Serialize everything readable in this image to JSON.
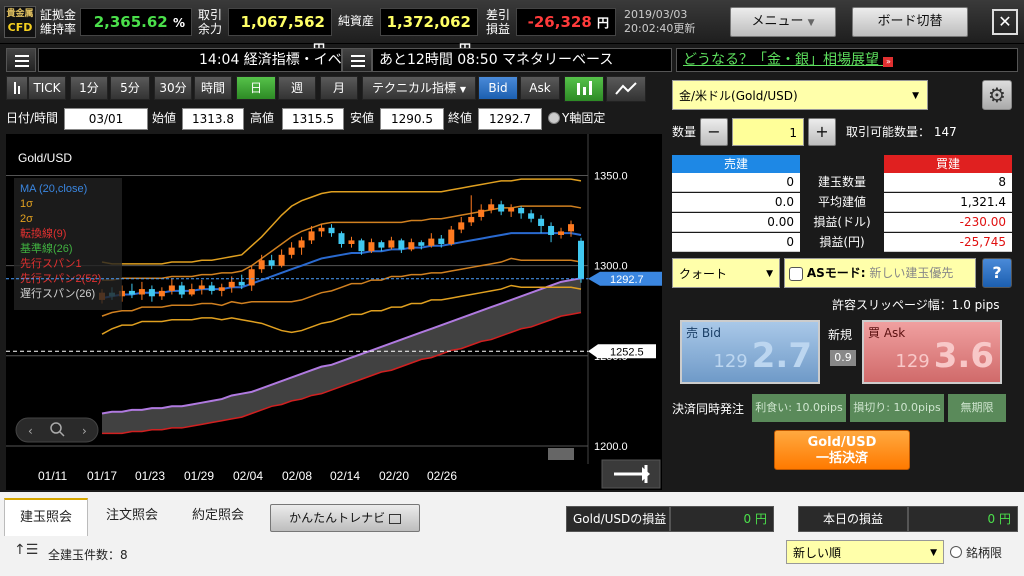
{
  "header": {
    "logo_line1": "貴金属",
    "logo_line2": "CFD",
    "margin_label1": "証拠金",
    "margin_label2": "維持率",
    "margin_value": "2,365.62",
    "margin_unit": "%",
    "avail_label1": "取引",
    "avail_label2": "余力",
    "avail_value": "1,067,562",
    "yen": "円",
    "net_label": "純資産",
    "net_value": "1,372,062",
    "pl_label1": "差引",
    "pl_label2": "損益",
    "pl_value": "-26,328",
    "date": "2019/03/03",
    "time_updated": "20:02:40更新",
    "menu_label": "メニュー",
    "board_label": "ボード切替",
    "close_glyph": "✕"
  },
  "tickers": {
    "t1": "14:04 経済指標・イベ",
    "t2": "あと12時間 08:50 マネタリーベース",
    "t3": "どうなる？「金・銀」相場展望"
  },
  "toolbar": {
    "items": [
      "TICK",
      "1分",
      "5分",
      "30分",
      "時間",
      "日",
      "週",
      "月"
    ],
    "tech": "テクニカル指標",
    "bid": "Bid",
    "ask": "Ask"
  },
  "ohlc": {
    "date_label": "日付/時間",
    "date": "03/01",
    "open_label": "始値",
    "open": "1313.8",
    "high_label": "高値",
    "high": "1315.5",
    "low_label": "安値",
    "low": "1290.5",
    "close_label": "終値",
    "close": "1292.7",
    "yfix_label": "Y軸固定"
  },
  "chart_data": {
    "type": "candlestick",
    "symbol": "Gold/USD",
    "legend": [
      "MA (20,close)",
      "1σ",
      "2σ",
      "転換線(9)",
      "基準線(26)",
      "先行スパン1",
      "先行スパン2(52)",
      "遅行スパン(26)"
    ],
    "y_ticks": [
      1350.0,
      1300.0,
      1250.0,
      1200.0
    ],
    "y_tick_labels": [
      "1350.0",
      "1300.0",
      "1250.0",
      "1200.0"
    ],
    "ylim": [
      1190,
      1373
    ],
    "x_labels": [
      "01/11",
      "01/17",
      "01/23",
      "01/29",
      "02/04",
      "02/08",
      "02/14",
      "02/20",
      "02/26"
    ],
    "current_price": "1292.7",
    "marker_price": "1252.5",
    "candles": [
      [
        1281,
        1285,
        1279,
        1287
      ],
      [
        1285,
        1283,
        1281,
        1288
      ],
      [
        1283,
        1286,
        1280,
        1289
      ],
      [
        1286,
        1284,
        1282,
        1290
      ],
      [
        1284,
        1287,
        1281,
        1291
      ],
      [
        1287,
        1283,
        1280,
        1289
      ],
      [
        1283,
        1286,
        1281,
        1288
      ],
      [
        1286,
        1289,
        1284,
        1293
      ],
      [
        1289,
        1284,
        1282,
        1291
      ],
      [
        1284,
        1287,
        1283,
        1290
      ],
      [
        1287,
        1289,
        1284,
        1292
      ],
      [
        1289,
        1286,
        1284,
        1291
      ],
      [
        1286,
        1288,
        1283,
        1290
      ],
      [
        1288,
        1291,
        1285,
        1294
      ],
      [
        1291,
        1289,
        1287,
        1295
      ],
      [
        1289,
        1298,
        1286,
        1300
      ],
      [
        1298,
        1303,
        1296,
        1306
      ],
      [
        1303,
        1300,
        1298,
        1306
      ],
      [
        1300,
        1306,
        1299,
        1309
      ],
      [
        1306,
        1310,
        1304,
        1313
      ],
      [
        1310,
        1314,
        1306,
        1316
      ],
      [
        1314,
        1319,
        1312,
        1322
      ],
      [
        1319,
        1321,
        1316,
        1323
      ],
      [
        1321,
        1318,
        1316,
        1323
      ],
      [
        1318,
        1312,
        1310,
        1319
      ],
      [
        1312,
        1314,
        1310,
        1316
      ],
      [
        1314,
        1308,
        1306,
        1315
      ],
      [
        1308,
        1313,
        1307,
        1315
      ],
      [
        1313,
        1310,
        1308,
        1314
      ],
      [
        1310,
        1314,
        1309,
        1316
      ],
      [
        1314,
        1309,
        1307,
        1315
      ],
      [
        1309,
        1313,
        1308,
        1315
      ],
      [
        1313,
        1311,
        1309,
        1314
      ],
      [
        1311,
        1315,
        1310,
        1318
      ],
      [
        1315,
        1312,
        1310,
        1317
      ],
      [
        1312,
        1320,
        1311,
        1322
      ],
      [
        1320,
        1324,
        1318,
        1327
      ],
      [
        1324,
        1327,
        1322,
        1339
      ],
      [
        1327,
        1331,
        1325,
        1334
      ],
      [
        1331,
        1334,
        1329,
        1337
      ],
      [
        1334,
        1330,
        1328,
        1336
      ],
      [
        1330,
        1332,
        1327,
        1334
      ],
      [
        1332,
        1329,
        1326,
        1333
      ],
      [
        1329,
        1326,
        1324,
        1331
      ],
      [
        1326,
        1322,
        1318,
        1328
      ],
      [
        1322,
        1317,
        1313,
        1324
      ],
      [
        1317,
        1319,
        1315,
        1321
      ],
      [
        1319,
        1323,
        1316,
        1325
      ],
      [
        1313.8,
        1292.7,
        1290.5,
        1315.5
      ]
    ],
    "ma20": [
      1282,
      1283,
      1284,
      1284,
      1285,
      1285,
      1285,
      1286,
      1286,
      1286,
      1287,
      1287,
      1287,
      1288,
      1288,
      1290,
      1292,
      1294,
      1296,
      1298,
      1300,
      1302,
      1304,
      1305,
      1306,
      1307,
      1307,
      1308,
      1308,
      1309,
      1309,
      1310,
      1310,
      1311,
      1311,
      1312,
      1313,
      1314,
      1315,
      1316,
      1317,
      1318,
      1318,
      1318,
      1318,
      1318,
      1318,
      1318,
      1317
    ],
    "sigma1_upper": [
      1292,
      1292,
      1293,
      1293,
      1293,
      1293,
      1293,
      1294,
      1294,
      1294,
      1295,
      1295,
      1296,
      1296,
      1297,
      1300,
      1304,
      1308,
      1312,
      1316,
      1319,
      1321,
      1323,
      1324,
      1324,
      1324,
      1324,
      1324,
      1324,
      1324,
      1324,
      1325,
      1325,
      1326,
      1326,
      1327,
      1328,
      1329,
      1330,
      1331,
      1332,
      1332,
      1333,
      1333,
      1333,
      1333,
      1333,
      1333,
      1332
    ],
    "sigma2_upper": [
      1302,
      1301,
      1301,
      1301,
      1301,
      1301,
      1301,
      1302,
      1302,
      1302,
      1303,
      1303,
      1304,
      1305,
      1306,
      1311,
      1316,
      1322,
      1328,
      1333,
      1336,
      1338,
      1340,
      1341,
      1341,
      1341,
      1341,
      1341,
      1341,
      1341,
      1341,
      1341,
      1341,
      1341,
      1341,
      1342,
      1343,
      1344,
      1345,
      1346,
      1347,
      1347,
      1348,
      1348,
      1348,
      1348,
      1348,
      1348,
      1347
    ],
    "sigma1_lower": [
      1272,
      1274,
      1275,
      1275,
      1277,
      1277,
      1277,
      1278,
      1278,
      1278,
      1279,
      1279,
      1278,
      1280,
      1279,
      1280,
      1280,
      1280,
      1280,
      1280,
      1281,
      1283,
      1285,
      1286,
      1288,
      1290,
      1290,
      1292,
      1292,
      1294,
      1294,
      1295,
      1295,
      1296,
      1296,
      1297,
      1298,
      1299,
      1300,
      1301,
      1302,
      1304,
      1303,
      1303,
      1303,
      1303,
      1303,
      1303,
      1302
    ],
    "sigma2_lower": [
      1262,
      1265,
      1267,
      1267,
      1269,
      1269,
      1269,
      1270,
      1270,
      1270,
      1271,
      1271,
      1270,
      1271,
      1270,
      1269,
      1268,
      1266,
      1264,
      1263,
      1264,
      1266,
      1268,
      1269,
      1271,
      1273,
      1273,
      1275,
      1275,
      1277,
      1277,
      1279,
      1279,
      1281,
      1281,
      1282,
      1283,
      1284,
      1285,
      1286,
      1287,
      1289,
      1288,
      1288,
      1288,
      1288,
      1288,
      1288,
      1287
    ],
    "span_a": [
      1218,
      1219,
      1219,
      1220,
      1220,
      1221,
      1221,
      1222,
      1222,
      1223,
      1224,
      1225,
      1226,
      1228,
      1229,
      1230,
      1232,
      1234,
      1236,
      1238,
      1240,
      1242,
      1244,
      1245,
      1247,
      1249,
      1251,
      1253,
      1255,
      1257,
      1259,
      1261,
      1263,
      1265,
      1267,
      1269,
      1271,
      1273,
      1275,
      1277,
      1279,
      1281,
      1283,
      1285,
      1287,
      1289,
      1291,
      1292,
      1293
    ],
    "span_b": [
      1207,
      1207,
      1207,
      1208,
      1208,
      1209,
      1209,
      1210,
      1210,
      1211,
      1212,
      1213,
      1214,
      1215,
      1216,
      1218,
      1220,
      1222,
      1223,
      1225,
      1226,
      1228,
      1229,
      1231,
      1233,
      1235,
      1237,
      1239,
      1241,
      1242,
      1244,
      1246,
      1248,
      1249,
      1251,
      1253,
      1254,
      1256,
      1258,
      1259,
      1261,
      1263,
      1265,
      1266,
      1268,
      1270,
      1272,
      1273,
      1274
    ]
  },
  "order": {
    "symbol": "金/米ドル(Gold/USD)",
    "qty_label": "数量",
    "minus": "−",
    "qty": "1",
    "plus": "+",
    "avail_qty_label": "取引可能数量：",
    "avail_qty": "147",
    "sell_header": "売建",
    "buy_header": "買建",
    "row_labels": [
      "建玉数量",
      "平均建値",
      "損益(ドル)",
      "損益(円)"
    ],
    "sell_values": [
      "0",
      "0.0",
      "0.00",
      "0"
    ],
    "buy_values": [
      "8",
      "1,321.4",
      "-230.00",
      "-25,745"
    ],
    "order_type": "クォート",
    "as_mode_label": "ASモード:",
    "as_mode_placeholder": "新しい建玉優先",
    "help": "?",
    "slippage": "許容スリッページ幅：1.0 pips",
    "sell_label": "売 Bid",
    "sell_price_small": "129",
    "sell_price_big": "2.7",
    "buy_label": "買 Ask",
    "buy_price_small": "129",
    "buy_price_big": "3.6",
    "new_label": "新規",
    "spread": "0.9",
    "settle_label": "決済同時発注",
    "profit_btn": "利食い: 10.0pips",
    "loss_btn": "損切り: 10.0pips",
    "indef_btn": "無期限",
    "bulk_line1": "Gold/USD",
    "bulk_line2": "一括決済"
  },
  "bottom": {
    "tabs": [
      "建玉照会",
      "注文照会",
      "約定照会"
    ],
    "trenavi": "かんたんトレナビ",
    "gold_pl_label": "Gold/USDの損益",
    "gold_pl_value": "0 円",
    "today_pl_label": "本日の損益",
    "today_pl_value": "0 円",
    "count": "全建玉件数：8",
    "sort": "新しい順",
    "brand": "銘柄限"
  },
  "colors": {
    "positive": "#4be04b",
    "negative": "#ff3b3b",
    "yellow": "#ffff66",
    "accent_green": "#3aa830"
  }
}
